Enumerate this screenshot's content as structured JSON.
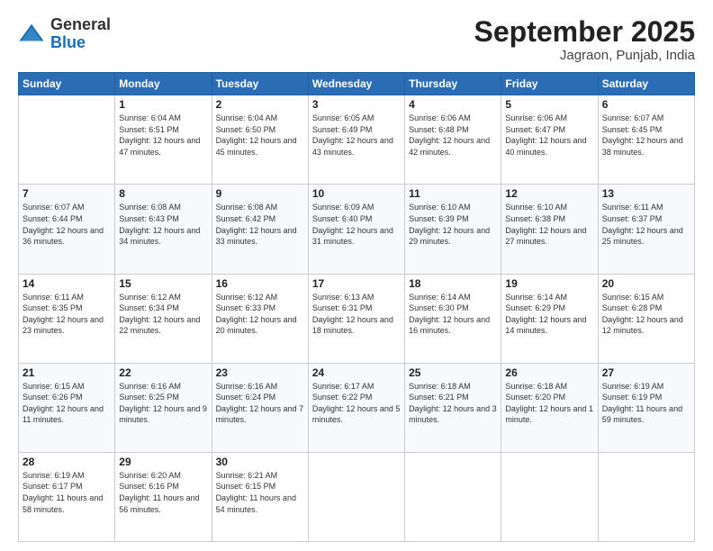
{
  "header": {
    "logo_general": "General",
    "logo_blue": "Blue",
    "month_title": "September 2025",
    "location": "Jagraon, Punjab, India"
  },
  "weekdays": [
    "Sunday",
    "Monday",
    "Tuesday",
    "Wednesday",
    "Thursday",
    "Friday",
    "Saturday"
  ],
  "weeks": [
    [
      {
        "day": "",
        "sunrise": "",
        "sunset": "",
        "daylight": ""
      },
      {
        "day": "1",
        "sunrise": "Sunrise: 6:04 AM",
        "sunset": "Sunset: 6:51 PM",
        "daylight": "Daylight: 12 hours and 47 minutes."
      },
      {
        "day": "2",
        "sunrise": "Sunrise: 6:04 AM",
        "sunset": "Sunset: 6:50 PM",
        "daylight": "Daylight: 12 hours and 45 minutes."
      },
      {
        "day": "3",
        "sunrise": "Sunrise: 6:05 AM",
        "sunset": "Sunset: 6:49 PM",
        "daylight": "Daylight: 12 hours and 43 minutes."
      },
      {
        "day": "4",
        "sunrise": "Sunrise: 6:06 AM",
        "sunset": "Sunset: 6:48 PM",
        "daylight": "Daylight: 12 hours and 42 minutes."
      },
      {
        "day": "5",
        "sunrise": "Sunrise: 6:06 AM",
        "sunset": "Sunset: 6:47 PM",
        "daylight": "Daylight: 12 hours and 40 minutes."
      },
      {
        "day": "6",
        "sunrise": "Sunrise: 6:07 AM",
        "sunset": "Sunset: 6:45 PM",
        "daylight": "Daylight: 12 hours and 38 minutes."
      }
    ],
    [
      {
        "day": "7",
        "sunrise": "Sunrise: 6:07 AM",
        "sunset": "Sunset: 6:44 PM",
        "daylight": "Daylight: 12 hours and 36 minutes."
      },
      {
        "day": "8",
        "sunrise": "Sunrise: 6:08 AM",
        "sunset": "Sunset: 6:43 PM",
        "daylight": "Daylight: 12 hours and 34 minutes."
      },
      {
        "day": "9",
        "sunrise": "Sunrise: 6:08 AM",
        "sunset": "Sunset: 6:42 PM",
        "daylight": "Daylight: 12 hours and 33 minutes."
      },
      {
        "day": "10",
        "sunrise": "Sunrise: 6:09 AM",
        "sunset": "Sunset: 6:40 PM",
        "daylight": "Daylight: 12 hours and 31 minutes."
      },
      {
        "day": "11",
        "sunrise": "Sunrise: 6:10 AM",
        "sunset": "Sunset: 6:39 PM",
        "daylight": "Daylight: 12 hours and 29 minutes."
      },
      {
        "day": "12",
        "sunrise": "Sunrise: 6:10 AM",
        "sunset": "Sunset: 6:38 PM",
        "daylight": "Daylight: 12 hours and 27 minutes."
      },
      {
        "day": "13",
        "sunrise": "Sunrise: 6:11 AM",
        "sunset": "Sunset: 6:37 PM",
        "daylight": "Daylight: 12 hours and 25 minutes."
      }
    ],
    [
      {
        "day": "14",
        "sunrise": "Sunrise: 6:11 AM",
        "sunset": "Sunset: 6:35 PM",
        "daylight": "Daylight: 12 hours and 23 minutes."
      },
      {
        "day": "15",
        "sunrise": "Sunrise: 6:12 AM",
        "sunset": "Sunset: 6:34 PM",
        "daylight": "Daylight: 12 hours and 22 minutes."
      },
      {
        "day": "16",
        "sunrise": "Sunrise: 6:12 AM",
        "sunset": "Sunset: 6:33 PM",
        "daylight": "Daylight: 12 hours and 20 minutes."
      },
      {
        "day": "17",
        "sunrise": "Sunrise: 6:13 AM",
        "sunset": "Sunset: 6:31 PM",
        "daylight": "Daylight: 12 hours and 18 minutes."
      },
      {
        "day": "18",
        "sunrise": "Sunrise: 6:14 AM",
        "sunset": "Sunset: 6:30 PM",
        "daylight": "Daylight: 12 hours and 16 minutes."
      },
      {
        "day": "19",
        "sunrise": "Sunrise: 6:14 AM",
        "sunset": "Sunset: 6:29 PM",
        "daylight": "Daylight: 12 hours and 14 minutes."
      },
      {
        "day": "20",
        "sunrise": "Sunrise: 6:15 AM",
        "sunset": "Sunset: 6:28 PM",
        "daylight": "Daylight: 12 hours and 12 minutes."
      }
    ],
    [
      {
        "day": "21",
        "sunrise": "Sunrise: 6:15 AM",
        "sunset": "Sunset: 6:26 PM",
        "daylight": "Daylight: 12 hours and 11 minutes."
      },
      {
        "day": "22",
        "sunrise": "Sunrise: 6:16 AM",
        "sunset": "Sunset: 6:25 PM",
        "daylight": "Daylight: 12 hours and 9 minutes."
      },
      {
        "day": "23",
        "sunrise": "Sunrise: 6:16 AM",
        "sunset": "Sunset: 6:24 PM",
        "daylight": "Daylight: 12 hours and 7 minutes."
      },
      {
        "day": "24",
        "sunrise": "Sunrise: 6:17 AM",
        "sunset": "Sunset: 6:22 PM",
        "daylight": "Daylight: 12 hours and 5 minutes."
      },
      {
        "day": "25",
        "sunrise": "Sunrise: 6:18 AM",
        "sunset": "Sunset: 6:21 PM",
        "daylight": "Daylight: 12 hours and 3 minutes."
      },
      {
        "day": "26",
        "sunrise": "Sunrise: 6:18 AM",
        "sunset": "Sunset: 6:20 PM",
        "daylight": "Daylight: 12 hours and 1 minute."
      },
      {
        "day": "27",
        "sunrise": "Sunrise: 6:19 AM",
        "sunset": "Sunset: 6:19 PM",
        "daylight": "Daylight: 11 hours and 59 minutes."
      }
    ],
    [
      {
        "day": "28",
        "sunrise": "Sunrise: 6:19 AM",
        "sunset": "Sunset: 6:17 PM",
        "daylight": "Daylight: 11 hours and 58 minutes."
      },
      {
        "day": "29",
        "sunrise": "Sunrise: 6:20 AM",
        "sunset": "Sunset: 6:16 PM",
        "daylight": "Daylight: 11 hours and 56 minutes."
      },
      {
        "day": "30",
        "sunrise": "Sunrise: 6:21 AM",
        "sunset": "Sunset: 6:15 PM",
        "daylight": "Daylight: 11 hours and 54 minutes."
      },
      {
        "day": "",
        "sunrise": "",
        "sunset": "",
        "daylight": ""
      },
      {
        "day": "",
        "sunrise": "",
        "sunset": "",
        "daylight": ""
      },
      {
        "day": "",
        "sunrise": "",
        "sunset": "",
        "daylight": ""
      },
      {
        "day": "",
        "sunrise": "",
        "sunset": "",
        "daylight": ""
      }
    ]
  ]
}
